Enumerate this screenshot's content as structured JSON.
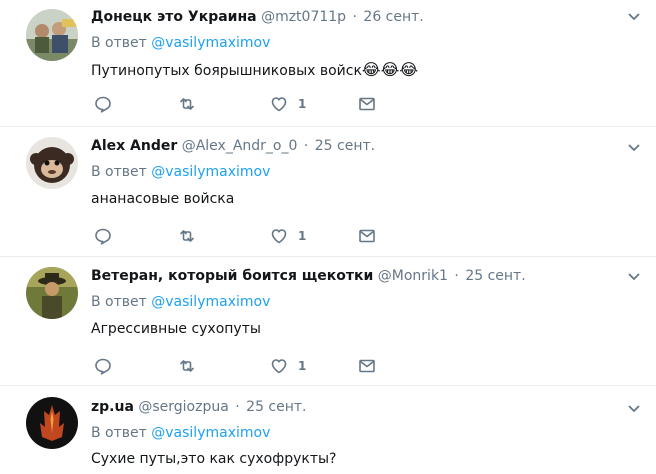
{
  "tweets": [
    {
      "fullname": "Донецк это Украина",
      "username": "@mzt0711p",
      "time": "26 сент.",
      "reply_prefix": "В ответ",
      "reply_mention": "@vasilymaximov",
      "text": "Путинопутых боярышниковых войск",
      "emoji": "😂😂😂",
      "likes": "1",
      "icons": [
        "reply-icon",
        "retweet-icon",
        "like-icon",
        "message-icon",
        "chevron-down-icon"
      ]
    },
    {
      "fullname": "Alex Ander",
      "username": "@Alex_Andr_o_0",
      "time": "25 сент.",
      "reply_prefix": "В ответ",
      "reply_mention": "@vasilymaximov",
      "text": "ананасовые войска",
      "emoji": "",
      "likes": "1"
    },
    {
      "fullname": "Ветеран, который боится щекотки",
      "username": "@Monrik1",
      "time": "25 сент.",
      "reply_prefix": "В ответ",
      "reply_mention": "@vasilymaximov",
      "text": "Агрессивные сухопуты",
      "emoji": "",
      "likes": "1"
    },
    {
      "fullname": "zp.ua",
      "username": "@sergiozpua",
      "time": "25 сент.",
      "reply_prefix": "В ответ",
      "reply_mention": "@vasilymaximov",
      "text": "Сухие путы,это как сухофрукты?",
      "emoji": "",
      "likes": ""
    }
  ],
  "separator": "·",
  "colors": {
    "link": "#1da1f2",
    "secondary": "#657786",
    "text": "#14171a",
    "divider": "#e6ecf0"
  }
}
